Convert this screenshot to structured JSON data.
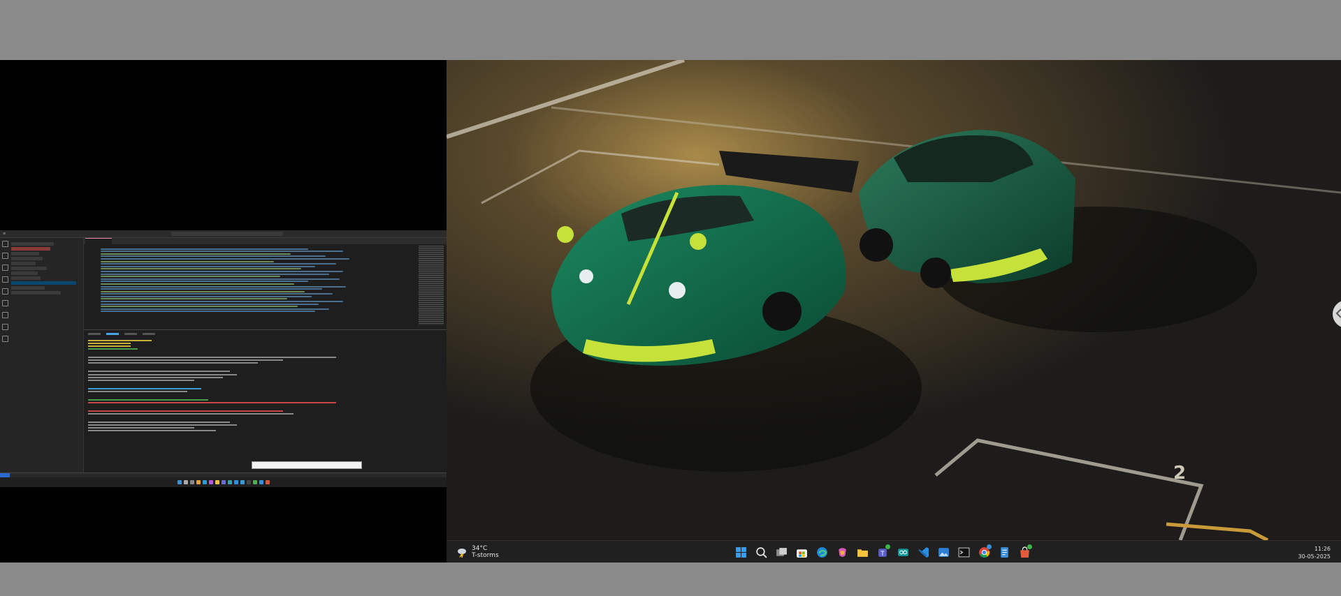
{
  "left_pane": {
    "vscode": {
      "title_hint": "",
      "tabs": [
        "",
        ""
      ]
    },
    "mini_taskbar": {
      "icons": [
        "start-icon",
        "search-icon",
        "task-view-icon",
        "store-icon",
        "edge-icon",
        "copilot-icon",
        "files-icon",
        "teams-icon",
        "arduino-icon",
        "vscode-icon",
        "photos-icon",
        "terminal-icon",
        "chrome-icon",
        "notepad-icon",
        "store2-icon"
      ]
    }
  },
  "taskbar": {
    "weather": {
      "temperature": "34°C",
      "condition": "T-storms"
    },
    "clock": {
      "time": "11:26",
      "date": "30-05-2025"
    },
    "pinned_apps": [
      {
        "name": "start"
      },
      {
        "name": "search"
      },
      {
        "name": "task-view"
      },
      {
        "name": "microsoft-store"
      },
      {
        "name": "edge"
      },
      {
        "name": "copilot"
      },
      {
        "name": "file-explorer"
      },
      {
        "name": "teams"
      },
      {
        "name": "arduino"
      },
      {
        "name": "vscode"
      },
      {
        "name": "photos"
      },
      {
        "name": "terminal"
      },
      {
        "name": "chrome"
      },
      {
        "name": "notepad"
      },
      {
        "name": "store-bag"
      }
    ]
  },
  "wallpaper": {
    "parking_number": "2"
  },
  "colors": {
    "car_green": "#0f6b4b",
    "accent_lime": "#c6e13a",
    "asphalt": "#2b2a27"
  }
}
